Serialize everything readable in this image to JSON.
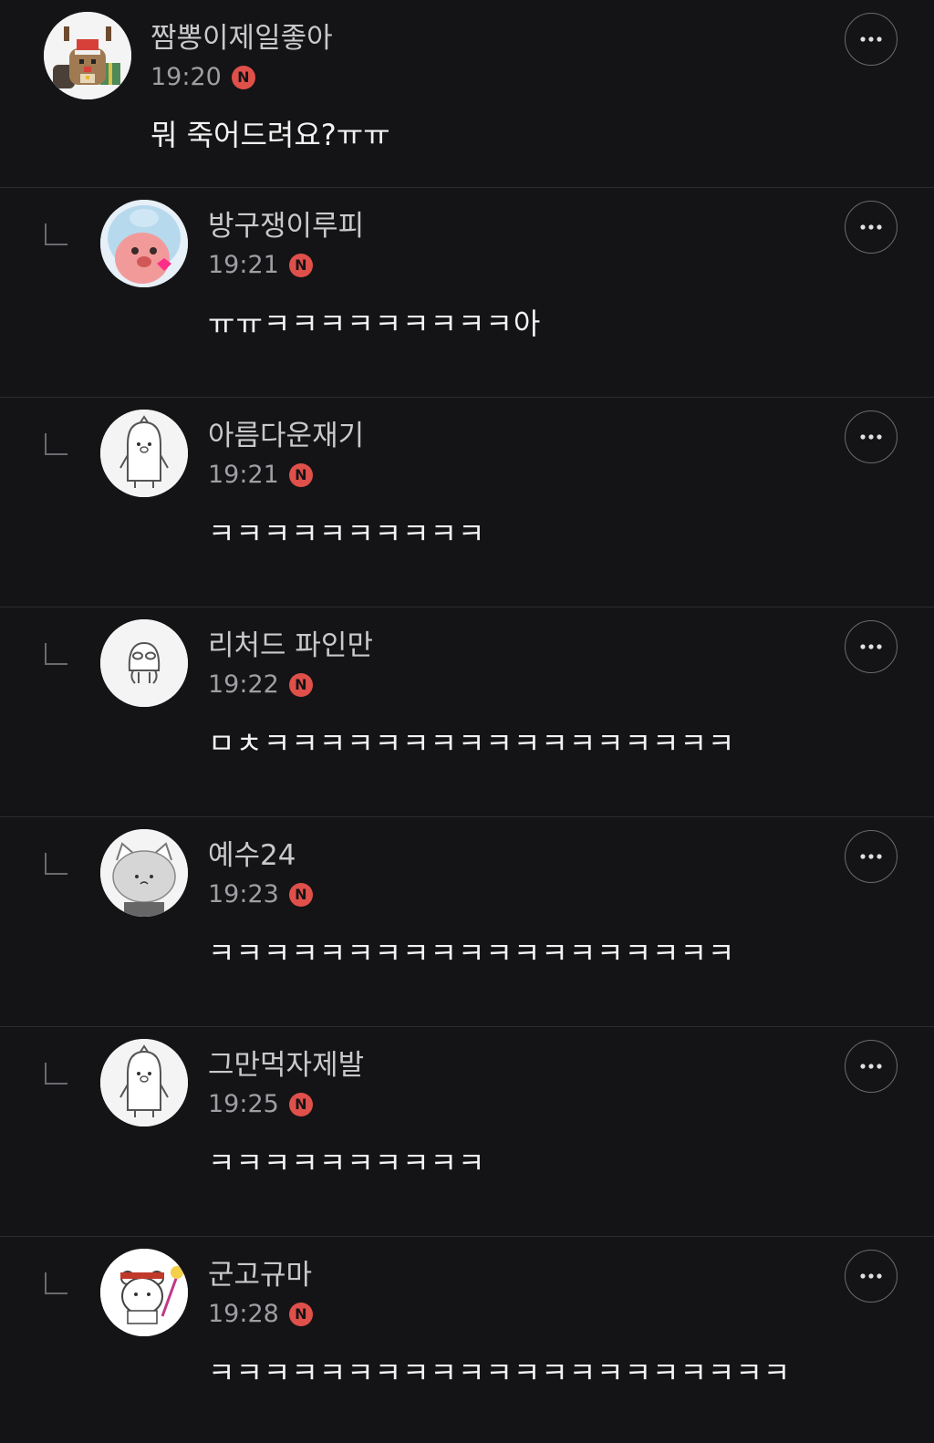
{
  "badge_letter": "N",
  "colors": {
    "background": "#141416",
    "badge": "#e0504a",
    "divider": "#2c2c30"
  },
  "comments": [
    {
      "author": "짬뽕이제일좋아",
      "time": "19:20",
      "text": "뭐 죽어드려요?ㅠㅠ",
      "is_reply": false,
      "avatar": "reindeer-avatar"
    },
    {
      "author": "방구쟁이루피",
      "time": "19:21",
      "text": "ㅠㅠㅋㅋㅋㅋㅋㅋㅋㅋㅋ아",
      "is_reply": true,
      "avatar": "loopy-avatar"
    },
    {
      "author": "아름다운재기",
      "time": "19:21",
      "text": "ㅋㅋㅋㅋㅋㅋㅋㅋㅋㅋ",
      "is_reply": true,
      "avatar": "penguin-avatar"
    },
    {
      "author": "리처드 파인만",
      "time": "19:22",
      "text": "ㅁㅊㅋㅋㅋㅋㅋㅋㅋㅋㅋㅋㅋㅋㅋㅋㅋㅋㅋ",
      "is_reply": true,
      "avatar": "alien-avatar"
    },
    {
      "author": "예수24",
      "time": "19:23",
      "text": "ㅋㅋㅋㅋㅋㅋㅋㅋㅋㅋㅋㅋㅋㅋㅋㅋㅋㅋㅋ",
      "is_reply": true,
      "avatar": "cat-avatar"
    },
    {
      "author": "그만먹자제발",
      "time": "19:25",
      "text": "ㅋㅋㅋㅋㅋㅋㅋㅋㅋㅋ",
      "is_reply": true,
      "avatar": "penguin-avatar"
    },
    {
      "author": "군고규마",
      "time": "19:28",
      "text": "ㅋㅋㅋㅋㅋㅋㅋㅋㅋㅋㅋㅋㅋㅋㅋㅋㅋㅋㅋㅋㅋ",
      "is_reply": true,
      "avatar": "bear-avatar"
    }
  ],
  "icons": {
    "more": "more-options-icon",
    "reply": "reply-arrow-icon",
    "badge": "new-badge-icon"
  }
}
